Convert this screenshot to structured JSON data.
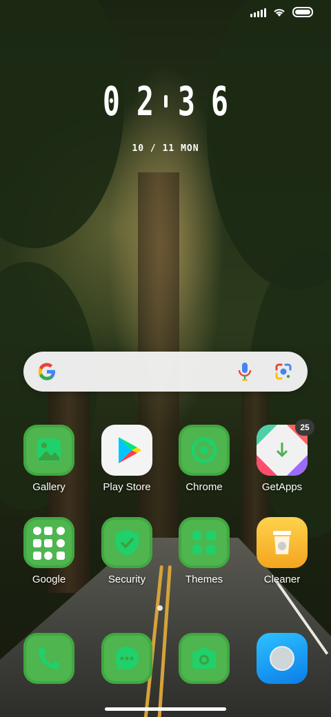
{
  "status_bar": {
    "signal_icon": "signal-icon",
    "wifi_icon": "wifi-icon",
    "battery_icon": "battery-icon"
  },
  "clock": {
    "h1": "0",
    "h2": "2",
    "m1": "3",
    "m2": "6",
    "date": "10 / 11 MON"
  },
  "search": {
    "google_icon": "google-g-icon",
    "mic_icon": "mic-icon",
    "lens_icon": "lens-icon"
  },
  "apps": [
    {
      "label": "Gallery",
      "icon": "gallery-icon"
    },
    {
      "label": "Play Store",
      "icon": "play-store-icon"
    },
    {
      "label": "Chrome",
      "icon": "chrome-icon"
    },
    {
      "label": "GetApps",
      "icon": "getapps-icon",
      "badge": "25"
    },
    {
      "label": "Google",
      "icon": "google-folder-icon"
    },
    {
      "label": "Security",
      "icon": "security-shield-icon"
    },
    {
      "label": "Themes",
      "icon": "themes-icon"
    },
    {
      "label": "Cleaner",
      "icon": "cleaner-trash-icon"
    }
  ],
  "dock": [
    {
      "icon": "phone-icon"
    },
    {
      "icon": "messages-icon"
    },
    {
      "icon": "camera-icon"
    },
    {
      "icon": "browser-icon"
    }
  ],
  "colors": {
    "icon_green": "#4fb54f",
    "icon_glyph_green": "#22c55e"
  }
}
